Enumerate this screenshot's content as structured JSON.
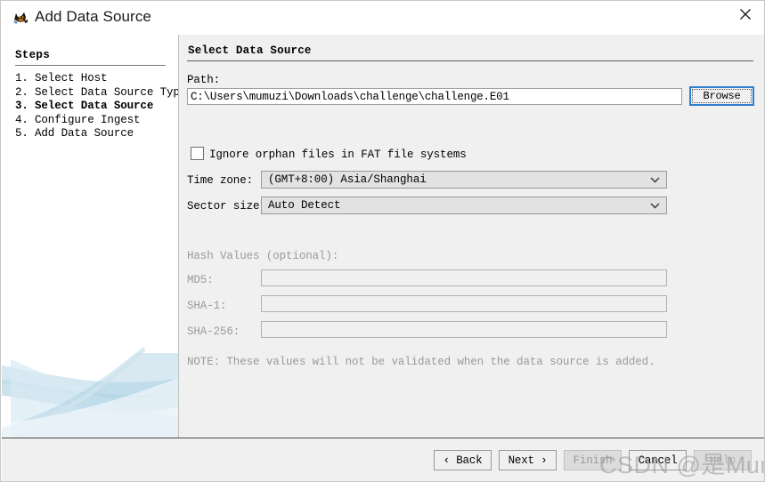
{
  "window": {
    "title": "Add Data Source",
    "app_icon": "autopsy-dog-icon",
    "close_icon": "close-icon"
  },
  "sidebar": {
    "heading": "Steps",
    "items": [
      {
        "num": "1.",
        "label": "Select Host",
        "current": false
      },
      {
        "num": "2.",
        "label": "Select Data Source Type",
        "current": false
      },
      {
        "num": "3.",
        "label": "Select Data Source",
        "current": true
      },
      {
        "num": "4.",
        "label": "Configure Ingest",
        "current": false
      },
      {
        "num": "5.",
        "label": "Add Data Source",
        "current": false
      }
    ]
  },
  "main": {
    "heading": "Select Data Source",
    "path": {
      "label": "Path:",
      "value": "C:\\Users\\mumuzi\\Downloads\\challenge\\challenge.E01",
      "browse_label": "Browse"
    },
    "orphan": {
      "label": "Ignore orphan files in FAT file systems",
      "checked": false
    },
    "timezone": {
      "label": "Time zone:",
      "value": "(GMT+8:00) Asia/Shanghai",
      "chevron": "chevron-down-icon"
    },
    "sector": {
      "label": "Sector size:",
      "value": "Auto Detect",
      "chevron": "chevron-down-icon"
    },
    "hash": {
      "heading": "Hash Values (optional):",
      "md5_label": "MD5:",
      "md5_value": "",
      "sha1_label": "SHA-1:",
      "sha1_value": "",
      "sha256_label": "SHA-256:",
      "sha256_value": "",
      "note": "NOTE: These values will not be validated when the data source is added."
    }
  },
  "footer": {
    "back_label": "‹ Back",
    "next_label": "Next ›",
    "finish_label": "Finish",
    "cancel_label": "Cancel",
    "help_label": "Help"
  },
  "watermark": {
    "text": "CSDN @是Mumuzi"
  },
  "colors": {
    "panel_bg": "#f0f0f0",
    "left_bg": "#ffffff",
    "focus_blue": "#2f7fd1",
    "disabled_text": "#9a9a9a",
    "swoosh": "#bcd9e6"
  }
}
